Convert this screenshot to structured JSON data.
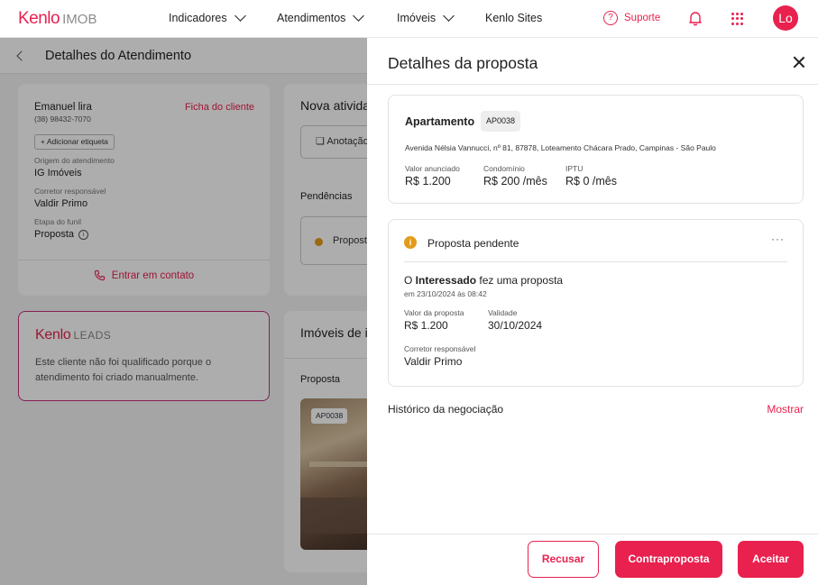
{
  "topbar": {
    "logo_main": "Kenlo",
    "logo_sub": "IMOB",
    "nav": [
      "Indicadores",
      "Atendimentos",
      "Imóveis",
      "Kenlo Sites"
    ],
    "support_label": "Suporte",
    "avatar_initials": "Lo"
  },
  "page": {
    "title": "Detalhes do Atendimento",
    "client": {
      "name": "Emanuel lira",
      "phone": "(38) 98432-7070",
      "ficha_link": "Ficha do cliente",
      "add_tag": "Adicionar etiqueta",
      "origin_label": "Origem do atendimento",
      "origin_value": "IG Imóveis",
      "broker_label": "Corretor responsável",
      "broker_value": "Valdir Primo",
      "funnel_label": "Etapa do funil",
      "funnel_value": "Proposta",
      "contact_label": "Entrar em contato"
    },
    "leads": {
      "logo_main": "Kenlo",
      "logo_sub": "LEADS",
      "text": "Este cliente não foi qualificado porque o atendimento foi criado manualmente."
    },
    "activity": {
      "title": "Nova atividade",
      "note_button": "Anotação",
      "pending_title": "Pendências",
      "pending_item": "Proposta"
    },
    "properties": {
      "title": "Imóveis de interesse",
      "section": "Proposta",
      "photo_tag": "AP0038"
    }
  },
  "drawer": {
    "title": "Detalhes da proposta",
    "property": {
      "type": "Apartamento",
      "code": "AP0038",
      "address": "Avenida Nélsia Vannucci, nº 81, 87878, Loteamento Chácara Prado, Campinas - São Paulo",
      "price_label": "Valor anunciado",
      "price_value": "R$ 1.200",
      "condo_label": "Condomínio",
      "condo_value": "R$ 200 /mês",
      "iptu_label": "IPTU",
      "iptu_value": "R$ 0 /mês"
    },
    "proposal": {
      "status": "Proposta pendente",
      "more": "···",
      "text_prefix": "O ",
      "text_bold": "Interessado",
      "text_suffix": " fez uma proposta",
      "date": "em 23/10/2024 às 08:42",
      "value_label": "Valor da proposta",
      "value_value": "R$ 1.200",
      "validity_label": "Validade",
      "validity_value": "30/10/2024",
      "broker_label": "Corretor responsável",
      "broker_value": "Valdir Primo"
    },
    "history_label": "Histórico da negociação",
    "history_link": "Mostrar",
    "buttons": {
      "reject": "Recusar",
      "counter": "Contraproposta",
      "accept": "Aceitar"
    }
  },
  "colors": {
    "accent": "#e8214f",
    "pending": "#e39b1a",
    "leads_border": "#c4307e"
  }
}
